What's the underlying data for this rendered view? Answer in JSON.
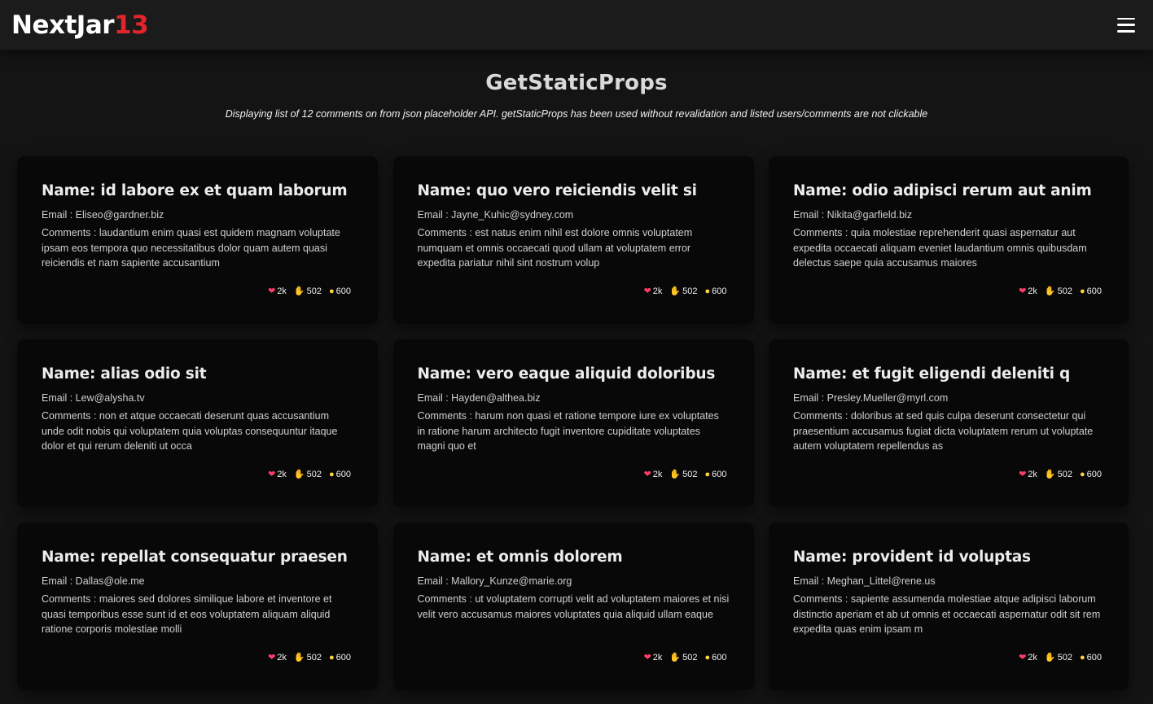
{
  "nav": {
    "logo_main": "NextJar",
    "logo_accent": "13"
  },
  "header": {
    "title": "GetStaticProps",
    "subtitle": "Displaying list of 12 comments on from json placeholder API. getStaticProps has been used without revalidation and listed users/comments are not clickable"
  },
  "labels": {
    "email_prefix": "Email : ",
    "comment_prefix": "Comments : "
  },
  "cards": [
    {
      "name": "Name: id labore ex et quam laborum",
      "email": "Email : Eliseo@gardner.biz",
      "comment": "Comments : laudantium enim quasi est quidem magnam voluptate ipsam eos tempora quo necessitatibus dolor quam autem quasi reiciendis et nam sapiente accusantium",
      "likes": "2k",
      "thumbs": "502",
      "ideas": "600"
    },
    {
      "name": "Name: quo vero reiciendis velit si",
      "email": "Email : Jayne_Kuhic@sydney.com",
      "comment": "Comments : est natus enim nihil est dolore omnis voluptatem numquam et omnis occaecati quod ullam at voluptatem error expedita pariatur nihil sint nostrum volup",
      "likes": "2k",
      "thumbs": "502",
      "ideas": "600"
    },
    {
      "name": "Name: odio adipisci rerum aut anim",
      "email": "Email : Nikita@garfield.biz",
      "comment": "Comments : quia molestiae reprehenderit quasi aspernatur aut expedita occaecati aliquam eveniet laudantium omnis quibusdam delectus saepe quia accusamus maiores",
      "likes": "2k",
      "thumbs": "502",
      "ideas": "600"
    },
    {
      "name": "Name: alias odio sit",
      "email": "Email : Lew@alysha.tv",
      "comment": "Comments : non et atque occaecati deserunt quas accusantium unde odit nobis qui voluptatem quia voluptas consequuntur itaque dolor et qui rerum deleniti ut occa",
      "likes": "2k",
      "thumbs": "502",
      "ideas": "600"
    },
    {
      "name": "Name: vero eaque aliquid doloribus",
      "email": "Email : Hayden@althea.biz",
      "comment": "Comments : harum non quasi et ratione tempore iure ex voluptates in ratione harum architecto fugit inventore cupiditate voluptates magni quo et",
      "likes": "2k",
      "thumbs": "502",
      "ideas": "600"
    },
    {
      "name": "Name: et fugit eligendi deleniti q",
      "email": "Email : Presley.Mueller@myrl.com",
      "comment": "Comments : doloribus at sed quis culpa deserunt consectetur qui praesentium accusamus fugiat dicta voluptatem rerum ut voluptate autem voluptatem repellendus as",
      "likes": "2k",
      "thumbs": "502",
      "ideas": "600"
    },
    {
      "name": "Name: repellat consequatur praesen",
      "email": "Email : Dallas@ole.me",
      "comment": "Comments : maiores sed dolores similique labore et inventore et quasi temporibus esse sunt id et eos voluptatem aliquam aliquid ratione corporis molestiae molli",
      "likes": "2k",
      "thumbs": "502",
      "ideas": "600"
    },
    {
      "name": "Name: et omnis dolorem",
      "email": "Email : Mallory_Kunze@marie.org",
      "comment": "Comments : ut voluptatem corrupti velit ad voluptatem maiores et nisi velit vero accusamus maiores voluptates quia aliquid ullam eaque",
      "likes": "2k",
      "thumbs": "502",
      "ideas": "600"
    },
    {
      "name": "Name: provident id voluptas",
      "email": "Email : Meghan_Littel@rene.us",
      "comment": "Comments : sapiente assumenda molestiae atque adipisci laborum distinctio aperiam et ab ut omnis et occaecati aspernatur odit sit rem expedita quas enim ipsam m",
      "likes": "2k",
      "thumbs": "502",
      "ideas": "600"
    }
  ],
  "icons": {
    "heart": "heart-icon",
    "thumb": "thumbs-up-icon",
    "bulb": "lightbulb-icon",
    "menu": "hamburger-menu-icon"
  },
  "colors": {
    "background": "#141414",
    "card": "#080808",
    "navbar": "#1b1b1b",
    "logo_accent": "#e0252b"
  }
}
